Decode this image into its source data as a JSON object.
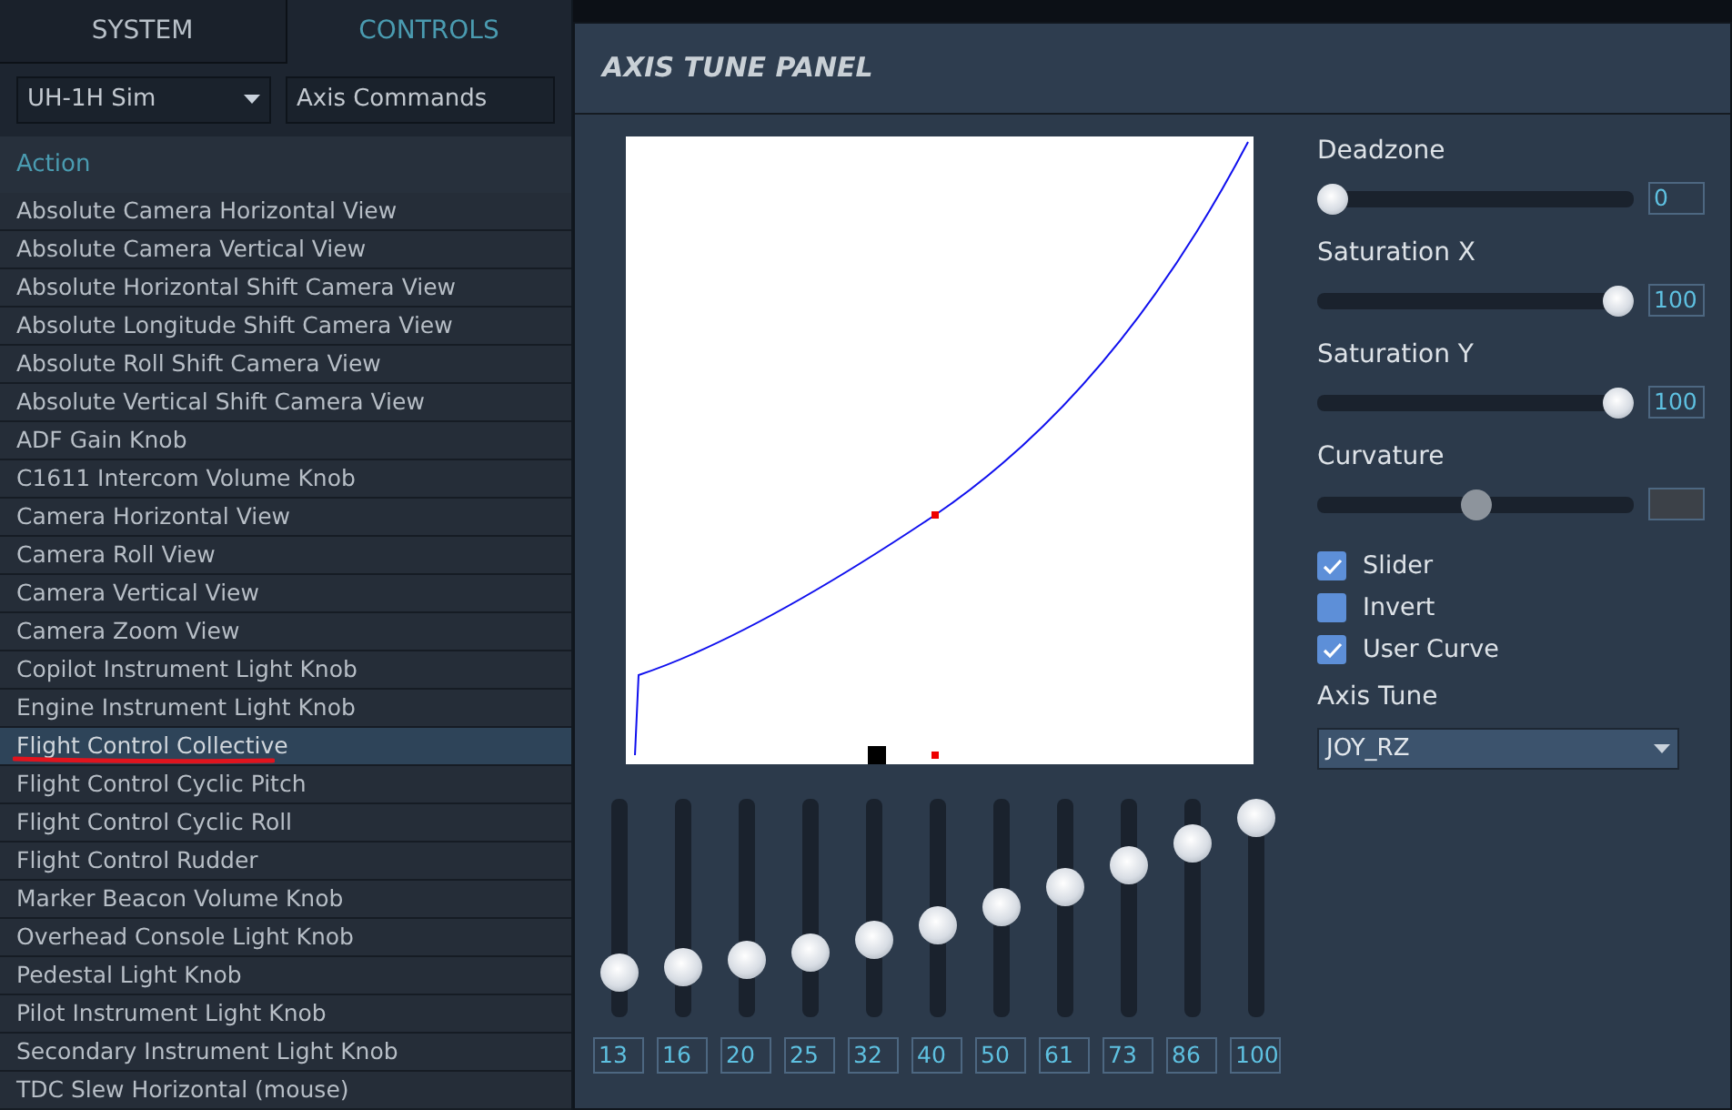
{
  "tabs": [
    {
      "label": "SYSTEM",
      "selected": false
    },
    {
      "label": "CONTROLS",
      "selected": true
    }
  ],
  "filters": [
    {
      "value": "UH-1H Sim",
      "kind": "dropdown"
    },
    {
      "value": "Axis Commands",
      "kind": "field"
    }
  ],
  "table": {
    "column_header": "Action",
    "rows": [
      {
        "label": "Absolute Camera Horizontal View",
        "selected": false,
        "marked": false
      },
      {
        "label": "Absolute Camera Vertical View",
        "selected": false,
        "marked": false
      },
      {
        "label": "Absolute Horizontal Shift Camera View",
        "selected": false,
        "marked": false
      },
      {
        "label": "Absolute Longitude Shift Camera View",
        "selected": false,
        "marked": false
      },
      {
        "label": "Absolute Roll Shift Camera View",
        "selected": false,
        "marked": false
      },
      {
        "label": "Absolute Vertical Shift Camera View",
        "selected": false,
        "marked": false
      },
      {
        "label": "ADF Gain Knob",
        "selected": false,
        "marked": false
      },
      {
        "label": "C1611 Intercom Volume Knob",
        "selected": false,
        "marked": false
      },
      {
        "label": "Camera Horizontal View",
        "selected": false,
        "marked": false
      },
      {
        "label": "Camera Roll View",
        "selected": false,
        "marked": false
      },
      {
        "label": "Camera Vertical View",
        "selected": false,
        "marked": false
      },
      {
        "label": "Camera Zoom View",
        "selected": false,
        "marked": false
      },
      {
        "label": "Copilot Instrument Light Knob",
        "selected": false,
        "marked": false
      },
      {
        "label": "Engine Instrument Light Knob",
        "selected": false,
        "marked": false
      },
      {
        "label": "Flight Control Collective",
        "selected": true,
        "marked": true
      },
      {
        "label": "Flight Control Cyclic Pitch",
        "selected": false,
        "marked": false
      },
      {
        "label": "Flight Control Cyclic Roll",
        "selected": false,
        "marked": false
      },
      {
        "label": "Flight Control Rudder",
        "selected": false,
        "marked": false
      },
      {
        "label": "Marker Beacon Volume Knob",
        "selected": false,
        "marked": false
      },
      {
        "label": "Overhead Console Light Knob",
        "selected": false,
        "marked": false
      },
      {
        "label": "Pedestal Light Knob",
        "selected": false,
        "marked": false
      },
      {
        "label": "Pilot Instrument Light Knob",
        "selected": false,
        "marked": false
      },
      {
        "label": "Secondary Instrument Light Knob",
        "selected": false,
        "marked": false
      },
      {
        "label": "TDC Slew Horizontal (mouse)",
        "selected": false,
        "marked": false
      }
    ]
  },
  "panel": {
    "title": "AXIS TUNE PANEL",
    "curve_points": [
      {
        "level": 0.13,
        "value": "13"
      },
      {
        "level": 0.16,
        "value": "16"
      },
      {
        "level": 0.2,
        "value": "20"
      },
      {
        "level": 0.25,
        "value": "25"
      },
      {
        "level": 0.32,
        "value": "32"
      },
      {
        "level": 0.4,
        "value": "40"
      },
      {
        "level": 0.5,
        "value": "50"
      },
      {
        "level": 0.61,
        "value": "61"
      },
      {
        "level": 0.73,
        "value": "73"
      },
      {
        "level": 0.86,
        "value": "86"
      },
      {
        "level": 1,
        "value": "100"
      }
    ],
    "sliders": [
      {
        "label": "Deadzone",
        "level": 0,
        "value": "0",
        "disabled": false
      },
      {
        "label": "Saturation X",
        "level": 1,
        "value": "100",
        "disabled": false
      },
      {
        "label": "Saturation Y",
        "level": 1,
        "value": "100",
        "disabled": false
      },
      {
        "label": "Curvature",
        "level": 0.5,
        "disabled": true
      }
    ],
    "checkboxes": [
      {
        "label": "Slider",
        "checked": true
      },
      {
        "label": "Invert",
        "checked": false
      },
      {
        "label": "User Curve",
        "checked": true
      }
    ],
    "axis_tune": {
      "label": "Axis Tune",
      "value": "JOY_RZ"
    }
  }
}
